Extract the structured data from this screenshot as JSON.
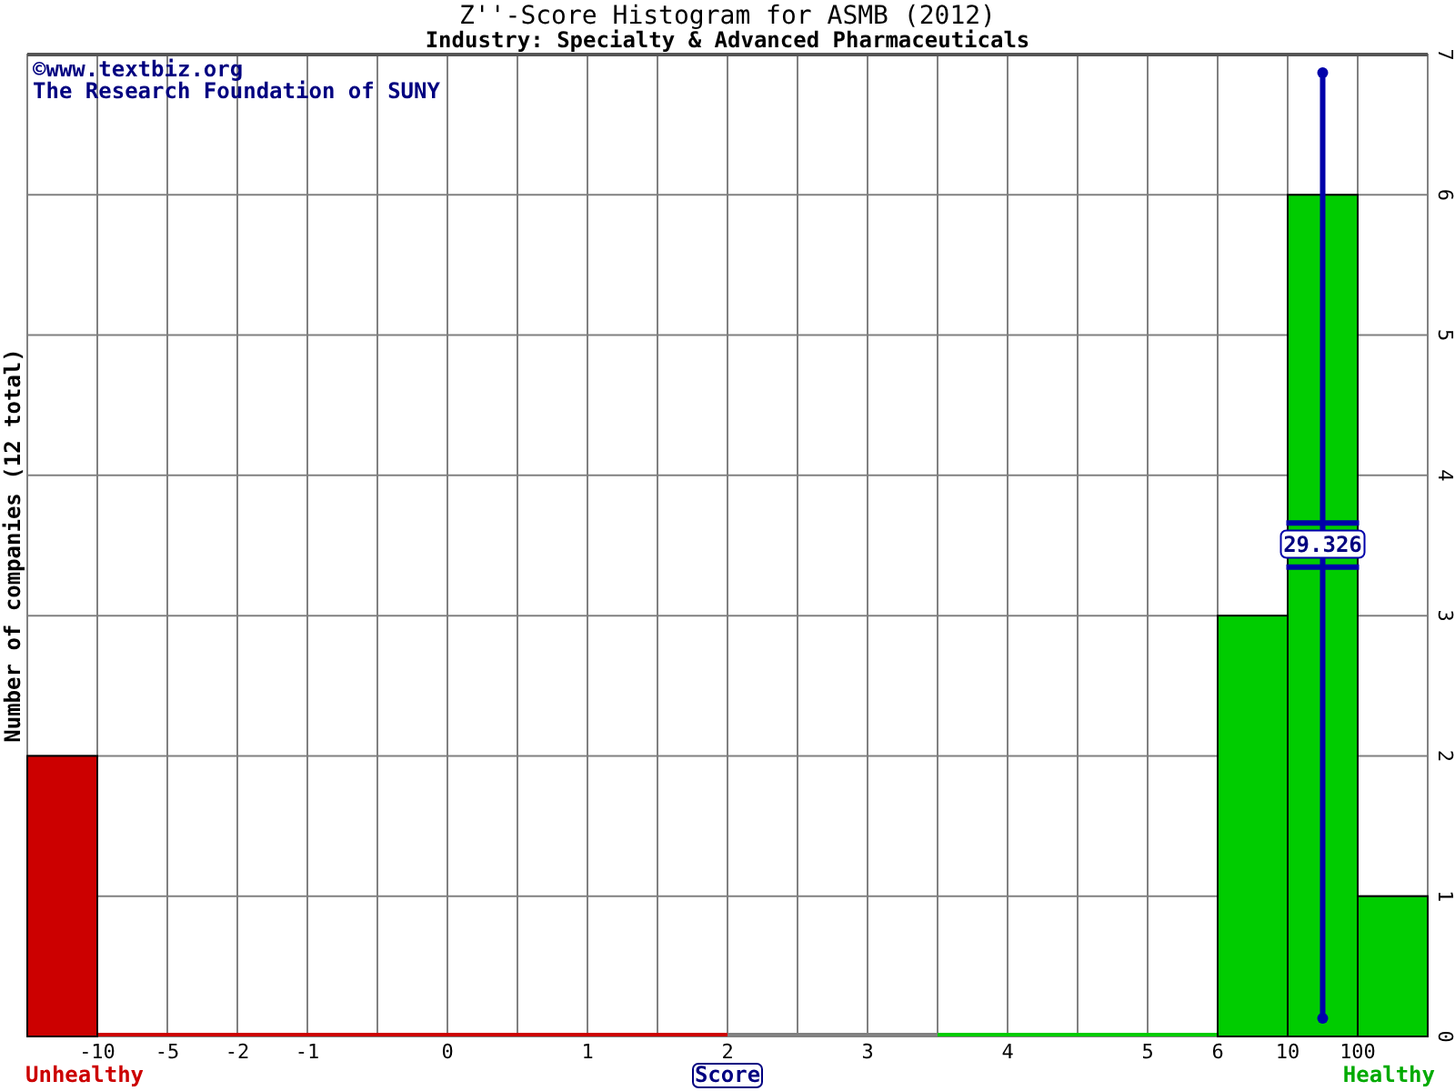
{
  "chart": {
    "subtitle": "Industry: Specialty & Advanced Pharmaceuticals",
    "credits": [
      "©www.textbiz.org",
      "The Research Foundation of SUNY"
    ],
    "left_label": "Unhealthy",
    "right_label": "Healthy",
    "x_tick_labels": [
      {
        "kind": "blank"
      },
      {
        "kind": "label",
        "text": "-10"
      },
      {
        "kind": "label",
        "text": "-5"
      },
      {
        "kind": "label",
        "text": "-2"
      },
      {
        "kind": "label",
        "text": "-1"
      },
      {
        "kind": "blank"
      },
      {
        "kind": "label",
        "text": "0"
      },
      {
        "kind": "blank"
      },
      {
        "kind": "label",
        "text": "1"
      },
      {
        "kind": "blank"
      },
      {
        "kind": "label",
        "text": "2"
      },
      {
        "kind": "blank"
      },
      {
        "kind": "label",
        "text": "3"
      },
      {
        "kind": "blank"
      },
      {
        "kind": "label",
        "text": "4"
      },
      {
        "kind": "blank"
      },
      {
        "kind": "label",
        "text": "5"
      },
      {
        "kind": "label",
        "text": "6"
      },
      {
        "kind": "label",
        "text": "10"
      },
      {
        "kind": "label",
        "text": "100"
      },
      {
        "kind": "blank"
      }
    ],
    "chart_data": {
      "type": "bar",
      "title": "Z''-Score Histogram for ASMB (2012)",
      "xlabel": "Score",
      "ylabel": "Number of companies (12 total)",
      "series": [
        {
          "color": "#cc0000",
          "values": [
            2,
            0,
            0,
            0,
            0,
            0,
            0,
            0,
            0,
            0,
            null,
            null,
            null,
            null,
            null,
            null,
            null,
            null,
            null,
            null
          ]
        },
        {
          "color": "#808080",
          "values": [
            null,
            null,
            null,
            null,
            null,
            null,
            null,
            null,
            null,
            null,
            0,
            0,
            0,
            null,
            null,
            null,
            null,
            null,
            null,
            null
          ]
        },
        {
          "color": "#00cc00",
          "values": [
            null,
            null,
            null,
            null,
            null,
            null,
            null,
            null,
            null,
            null,
            null,
            null,
            null,
            0,
            0,
            0,
            0,
            3,
            6,
            1
          ]
        }
      ],
      "ylim": [
        0,
        7
      ],
      "yticks": [
        0,
        1,
        2,
        3,
        4,
        5,
        6,
        7
      ],
      "grid": true,
      "annotations": [
        {
          "text": "29.326"
        }
      ]
    }
  }
}
